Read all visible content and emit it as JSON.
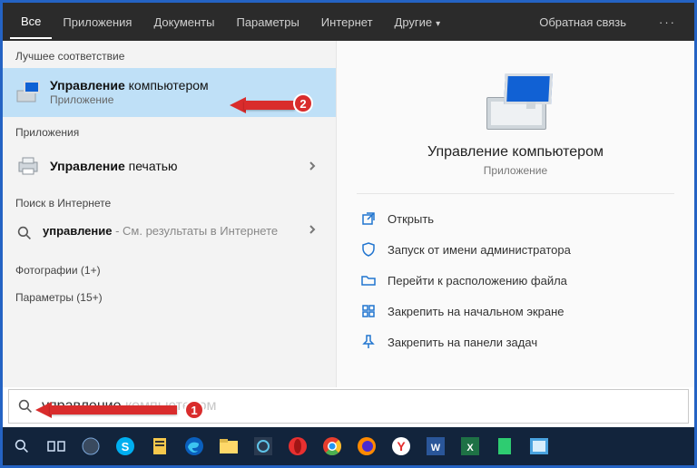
{
  "tabs": {
    "all": "Все",
    "apps": "Приложения",
    "docs": "Документы",
    "settings": "Параметры",
    "internet": "Интернет",
    "more": "Другие",
    "feedback": "Обратная связь"
  },
  "sections": {
    "best_match": "Лучшее соответствие",
    "apps": "Приложения",
    "web": "Поиск в Интернете",
    "photos": "Фотографии (1+)",
    "settings": "Параметры (15+)"
  },
  "results": {
    "main_bold": "Управление",
    "main_rest": " компьютером",
    "main_sub": "Приложение",
    "print_bold": "Управление",
    "print_rest": " печатью",
    "web_bold": "управление",
    "web_rest": " - См. результаты в Интернете"
  },
  "preview": {
    "title": "Управление компьютером",
    "subtitle": "Приложение"
  },
  "actions": {
    "open": "Открыть",
    "run_admin": "Запуск от имени администратора",
    "open_location": "Перейти к расположению файла",
    "pin_start": "Закрепить на начальном экране",
    "pin_taskbar": "Закрепить на панели задач"
  },
  "search": {
    "value": "управление",
    "placeholder": "компьютером"
  },
  "annotations": {
    "one": "1",
    "two": "2"
  }
}
